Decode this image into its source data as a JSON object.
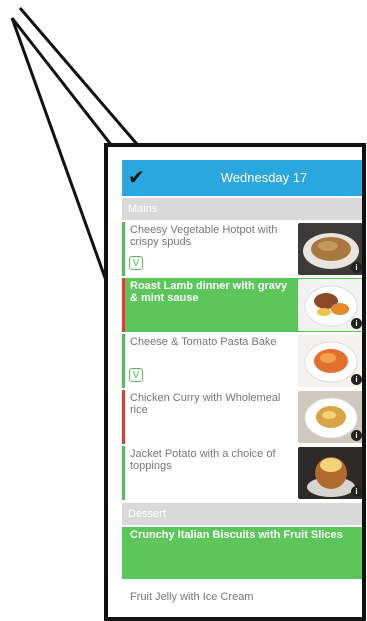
{
  "header": {
    "check_icon": "checkmark-icon",
    "date": "Wednesday 17"
  },
  "sections": {
    "mains": "Mains",
    "dessert": "Dessert"
  },
  "meals": [
    {
      "name": "Cheesy Vegetable Hotpot with crispy spuds",
      "vegetarian": true,
      "status_color": "#5cb85c"
    },
    {
      "name": "Roast Lamb dinner with gravy & mint sause",
      "vegetarian": false,
      "status_color": "#e53935",
      "selected": true
    },
    {
      "name": "Cheese & Tomato Pasta Bake",
      "vegetarian": true,
      "status_color": "#5cb85c"
    },
    {
      "name": "Chicken Curry with Wholemeal rice",
      "vegetarian": false,
      "status_color": "#e53935"
    },
    {
      "name": "Jacket Potato with a choice of toppings",
      "vegetarian": false,
      "status_color": "#5cb85c"
    }
  ],
  "desserts": [
    {
      "name": "Crunchy Italian Biscuits with Fruit Slices",
      "selected": true
    },
    {
      "name": "Fruit Jelly with Ice Cream",
      "selected": false
    }
  ],
  "colors": {
    "header": "#2aa7df",
    "selected": "#5cc65a",
    "section": "#d9d9d9"
  }
}
